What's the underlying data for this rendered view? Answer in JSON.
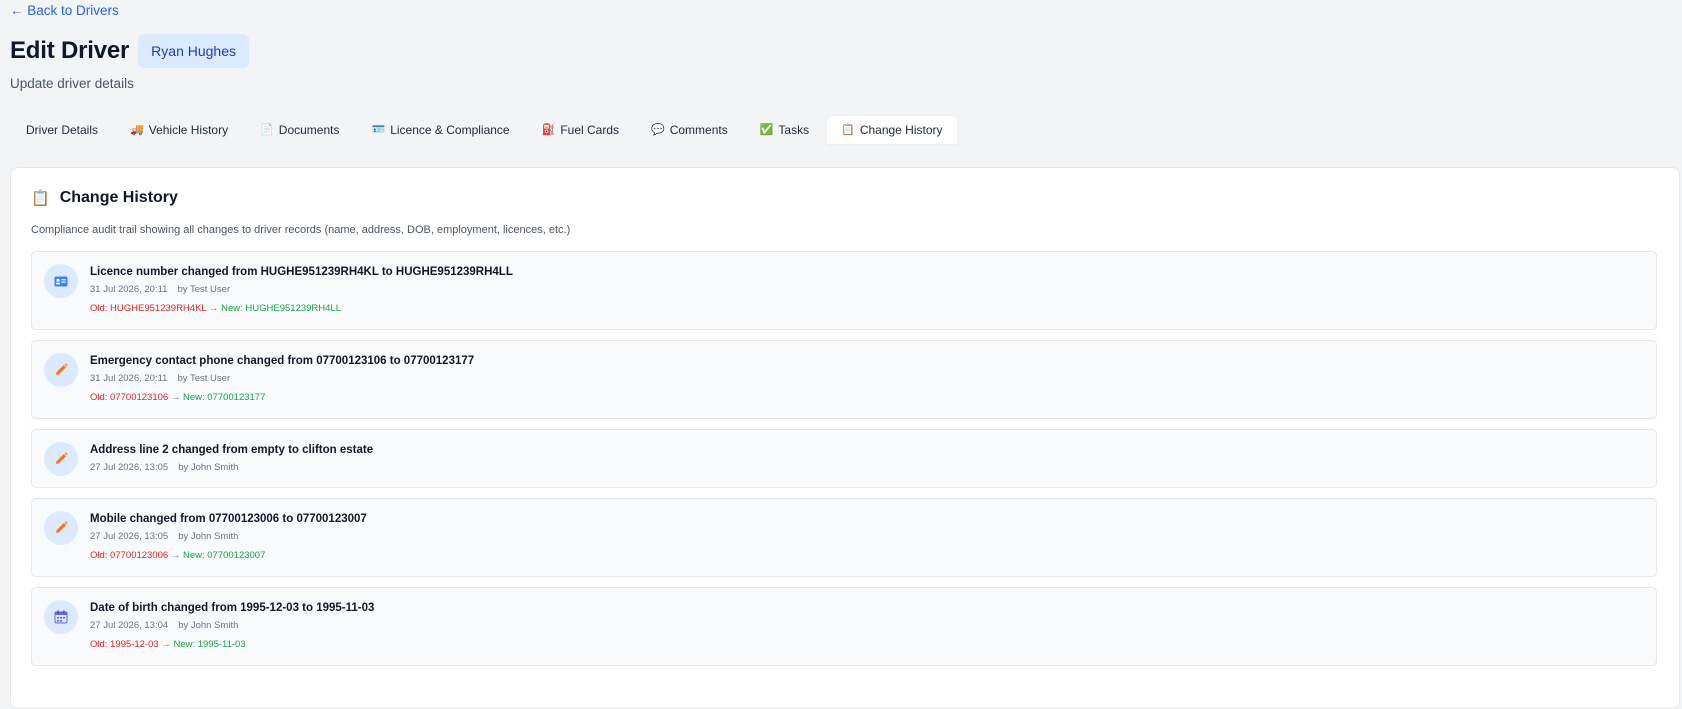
{
  "nav": {
    "back_label": "← Back to Drivers"
  },
  "header": {
    "title": "Edit Driver",
    "driver_name": "Ryan Hughes",
    "subtitle": "Update driver details"
  },
  "tabs": [
    {
      "label": "Driver Details",
      "icon": ""
    },
    {
      "label": "Vehicle History",
      "icon": "🚚"
    },
    {
      "label": "Documents",
      "icon": "📄"
    },
    {
      "label": "Licence & Compliance",
      "icon": "🪪"
    },
    {
      "label": "Fuel Cards",
      "icon": "⛽"
    },
    {
      "label": "Comments",
      "icon": "💬"
    },
    {
      "label": "Tasks",
      "icon": "✅"
    },
    {
      "label": "Change History",
      "icon": "📋",
      "active": true
    }
  ],
  "panel": {
    "icon": "📋",
    "title": "Change History",
    "description": "Compliance audit trail showing all changes to driver records (name, address, DOB, employment, licences, etc.)"
  },
  "entries": [
    {
      "icon": "licence-card-icon",
      "title": "Licence number changed from HUGHE951239RH4KL to HUGHE951239RH4LL",
      "timestamp": "31 Jul 2026, 20:11",
      "by": "by Test User",
      "old": "Old: HUGHE951239RH4KL",
      "arrow": "→",
      "new": "New: HUGHE951239RH4LL"
    },
    {
      "icon": "pencil-icon",
      "title": "Emergency contact phone changed from 07700123106 to 07700123177",
      "timestamp": "31 Jul 2026, 20:11",
      "by": "by Test User",
      "old": "Old: 07700123106",
      "arrow": "→",
      "new": "New: 07700123177"
    },
    {
      "icon": "pencil-icon",
      "title": "Address line 2 changed from empty to clifton estate",
      "timestamp": "27 Jul 2026, 13:05",
      "by": "by John Smith"
    },
    {
      "icon": "pencil-icon",
      "title": "Mobile changed from 07700123006 to 07700123007",
      "timestamp": "27 Jul 2026, 13:05",
      "by": "by John Smith",
      "old": "Old: 07700123006",
      "arrow": "→",
      "new": "New: 07700123007"
    },
    {
      "icon": "calendar-icon",
      "title": "Date of birth changed from 1995-12-03 to 1995-11-03",
      "timestamp": "27 Jul 2026, 13:04",
      "by": "by John Smith",
      "old": "Old: 1995-12-03",
      "arrow": "→",
      "new": "New: 1995-11-03"
    }
  ],
  "colors": {
    "accent": "#2563eb",
    "chip_bg": "#dbeafe",
    "old_value": "#dc2626",
    "new_value": "#16a34a",
    "pencil": "#f97316"
  }
}
